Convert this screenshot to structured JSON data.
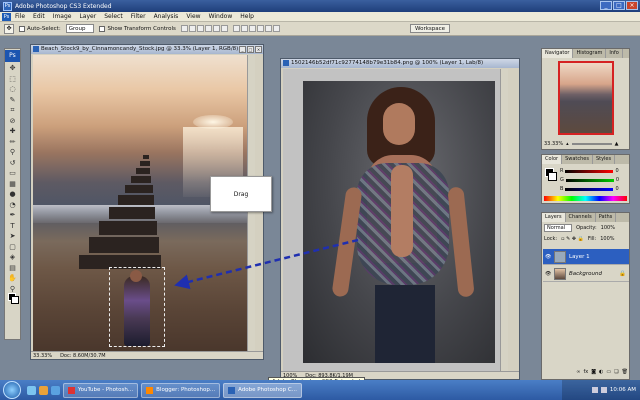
{
  "app": {
    "title": "Adobe Photoshop CS3 Extended",
    "logo": "Ps"
  },
  "menu": [
    "File",
    "Edit",
    "Image",
    "Layer",
    "Select",
    "Filter",
    "Analysis",
    "View",
    "Window",
    "Help"
  ],
  "options": {
    "auto_select_label": "Auto-Select:",
    "auto_select_value": "Group",
    "show_transform_label": "Show Transform Controls",
    "workspace_label": "Workspace"
  },
  "doc1": {
    "title": "Beach_Stock9_by_Cinnamoncandy_Stock.jpg @ 33.3% (Layer 1, RGB/8)",
    "zoom": "33.33%",
    "doc_info": "Doc: 8.60M/30.7M"
  },
  "doc2": {
    "title": "1502146b52df71c92774148b79e31b84.png @ 100% (Layer 1, Lab/8)",
    "zoom": "100%",
    "doc_info": "Doc: 893.8K/1.19M"
  },
  "callout": {
    "text": "Drag"
  },
  "navigator": {
    "tabs": [
      "Navigator",
      "Histogram",
      "Info"
    ],
    "zoom": "33.33%"
  },
  "color_panel": {
    "tabs": [
      "Color",
      "Swatches",
      "Styles"
    ],
    "channels": [
      {
        "label": "R",
        "value": "0"
      },
      {
        "label": "G",
        "value": "0"
      },
      {
        "label": "B",
        "value": "0"
      }
    ]
  },
  "layers_panel": {
    "tabs": [
      "Layers",
      "Channels",
      "Paths"
    ],
    "blend_mode": "Normal",
    "opacity_label": "Opacity:",
    "opacity_value": "100%",
    "lock_label": "Lock:",
    "fill_label": "Fill:",
    "fill_value": "100%",
    "layers": [
      {
        "name": "Layer 1",
        "active": true
      },
      {
        "name": "Background",
        "active": false
      }
    ]
  },
  "taskbar": {
    "tasks": [
      {
        "label": "YouTube - Photosh...",
        "color": "#d33"
      },
      {
        "label": "Blogger: Photoshop...",
        "color": "#f80"
      },
      {
        "label": "Adobe Photoshop C...",
        "color": "#2a62b5",
        "active": true
      }
    ],
    "clock": "10:06 AM"
  },
  "tooltip": {
    "text": "Adobe Photoshop CS3 Extended"
  }
}
